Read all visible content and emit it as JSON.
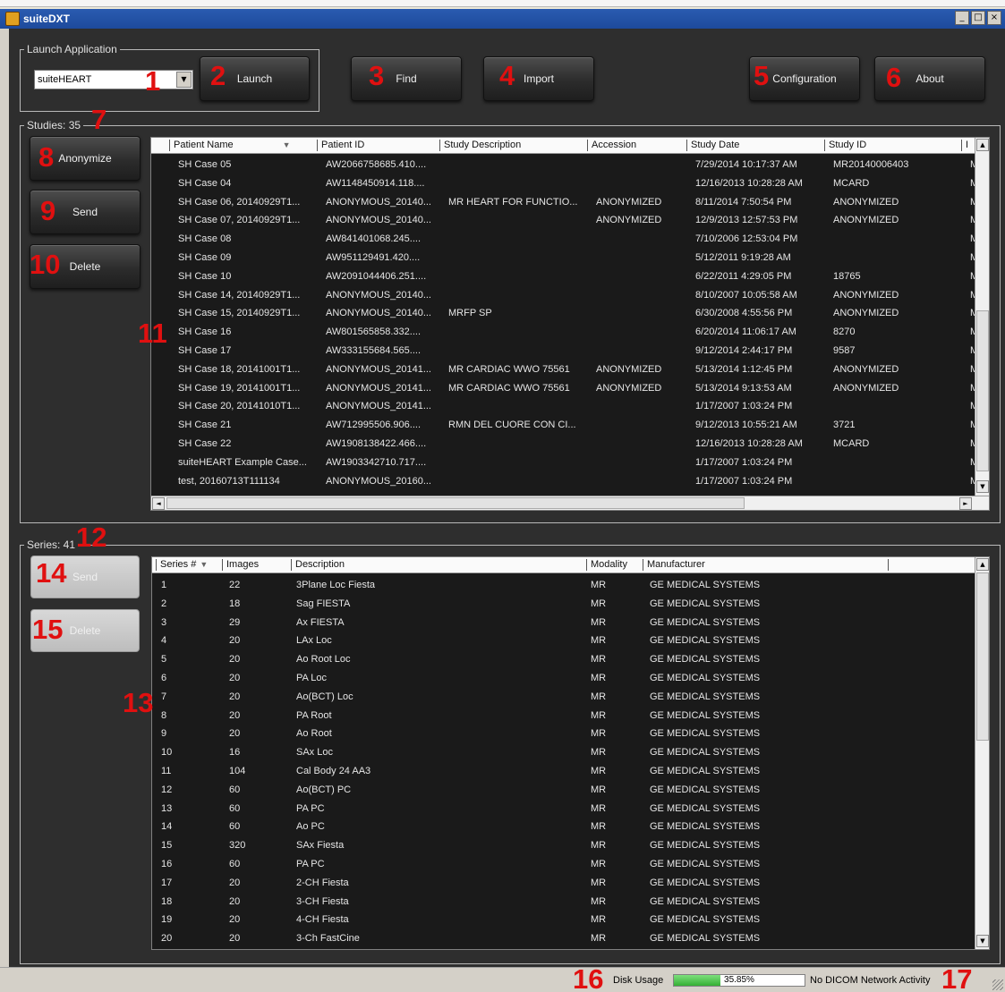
{
  "window": {
    "title": "suiteDXT",
    "minimize": "_",
    "maximize": "□",
    "close": "×"
  },
  "launch": {
    "legend": "Launch Application",
    "selected": "suiteHEART",
    "combo_arrow": "▼",
    "launch_label": "Launch"
  },
  "toolbar": {
    "find_label": "Find",
    "import_label": "Import",
    "configuration_label": "Configuration",
    "about_label": "About"
  },
  "studies": {
    "legend": "Studies: 35",
    "actions": {
      "anonymize": "Anonymize",
      "send": "Send",
      "delete": "Delete"
    },
    "sort_glyph": "▼",
    "columns": [
      "Patient Name",
      "Patient ID",
      "Study Description",
      "Accession",
      "Study Date",
      "Study ID",
      "I"
    ],
    "rows": [
      [
        "SH Case  05",
        "AW2066758685.410....",
        "",
        "",
        "7/29/2014 10:17:37 AM",
        "MR20140006403",
        "M"
      ],
      [
        "SH Case 04",
        "AW1148450914.118....",
        "",
        "",
        "12/16/2013 10:28:28 AM",
        "MCARD",
        "M"
      ],
      [
        "SH Case 06, 20140929T1...",
        "ANONYMOUS_20140...",
        "MR HEART FOR FUNCTIO...",
        "ANONYMIZED",
        "8/11/2014 7:50:54 PM",
        "ANONYMIZED",
        "M"
      ],
      [
        "SH Case 07, 20140929T1...",
        "ANONYMOUS_20140...",
        "",
        "ANONYMIZED",
        "12/9/2013 12:57:53 PM",
        "ANONYMIZED",
        "M"
      ],
      [
        "SH Case 08",
        "AW841401068.245....",
        "",
        "",
        "7/10/2006 12:53:04 PM",
        "",
        "M"
      ],
      [
        "SH Case 09",
        "AW951129491.420....",
        "",
        "",
        "5/12/2011 9:19:28 AM",
        "",
        "M"
      ],
      [
        "SH Case 10",
        "AW2091044406.251....",
        "",
        "",
        "6/22/2011 4:29:05 PM",
        "18765",
        "M"
      ],
      [
        "SH Case 14, 20140929T1...",
        "ANONYMOUS_20140...",
        "",
        "",
        "8/10/2007 10:05:58 AM",
        "ANONYMIZED",
        "M"
      ],
      [
        "SH Case 15, 20140929T1...",
        "ANONYMOUS_20140...",
        "MRFP SP",
        "",
        "6/30/2008 4:55:56 PM",
        "ANONYMIZED",
        "M"
      ],
      [
        "SH Case 16",
        "AW801565858.332....",
        "",
        "",
        "6/20/2014 11:06:17 AM",
        "8270",
        "M"
      ],
      [
        "SH Case 17",
        "AW333155684.565....",
        "",
        "",
        "9/12/2014 2:44:17 PM",
        "9587",
        "M"
      ],
      [
        "SH Case 18, 20141001T1...",
        "ANONYMOUS_20141...",
        "MR CARDIAC WWO 75561",
        "ANONYMIZED",
        "5/13/2014 1:12:45 PM",
        "ANONYMIZED",
        "M"
      ],
      [
        "SH Case 19, 20141001T1...",
        "ANONYMOUS_20141...",
        "MR CARDIAC WWO 75561",
        "ANONYMIZED",
        "5/13/2014 9:13:53 AM",
        "ANONYMIZED",
        "M"
      ],
      [
        "SH Case 20, 20141010T1...",
        "ANONYMOUS_20141...",
        "",
        "",
        "1/17/2007 1:03:24 PM",
        "",
        "M"
      ],
      [
        "SH Case 21",
        "AW712995506.906....",
        "RMN DEL CUORE CON CI...",
        "",
        "9/12/2013 10:55:21 AM",
        "3721",
        "M"
      ],
      [
        "SH Case 22",
        "AW1908138422.466....",
        "",
        "",
        "12/16/2013 10:28:28 AM",
        "MCARD",
        "M"
      ],
      [
        "suiteHEART Example Case...",
        "AW1903342710.717....",
        "",
        "",
        "1/17/2007 1:03:24 PM",
        "",
        "M"
      ],
      [
        "test, 20160713T111134",
        "ANONYMOUS_20160...",
        "",
        "",
        "1/17/2007 1:03:24 PM",
        "",
        "M"
      ]
    ]
  },
  "series": {
    "legend": "Series: 41",
    "actions": {
      "send": "Send",
      "delete": "Delete"
    },
    "sort_glyph": "▼",
    "columns": [
      "Series #",
      "Images",
      "Description",
      "Modality",
      "Manufacturer",
      ""
    ],
    "rows": [
      [
        "1",
        "22",
        "3Plane Loc Fiesta",
        "MR",
        "GE MEDICAL SYSTEMS"
      ],
      [
        "2",
        "18",
        "Sag FIESTA",
        "MR",
        "GE MEDICAL SYSTEMS"
      ],
      [
        "3",
        "29",
        "Ax FIESTA",
        "MR",
        "GE MEDICAL SYSTEMS"
      ],
      [
        "4",
        "20",
        "LAx Loc",
        "MR",
        "GE MEDICAL SYSTEMS"
      ],
      [
        "5",
        "20",
        "Ao Root Loc",
        "MR",
        "GE MEDICAL SYSTEMS"
      ],
      [
        "6",
        "20",
        "PA  Loc",
        "MR",
        "GE MEDICAL SYSTEMS"
      ],
      [
        "7",
        "20",
        "Ao(BCT) Loc",
        "MR",
        "GE MEDICAL SYSTEMS"
      ],
      [
        "8",
        "20",
        "PA Root",
        "MR",
        "GE MEDICAL SYSTEMS"
      ],
      [
        "9",
        "20",
        "Ao Root",
        "MR",
        "GE MEDICAL SYSTEMS"
      ],
      [
        "10",
        "16",
        "SAx Loc",
        "MR",
        "GE MEDICAL SYSTEMS"
      ],
      [
        "11",
        "104",
        "Cal Body 24 AA3",
        "MR",
        "GE MEDICAL SYSTEMS"
      ],
      [
        "12",
        "60",
        "Ao(BCT) PC",
        "MR",
        "GE MEDICAL SYSTEMS"
      ],
      [
        "13",
        "60",
        "PA PC",
        "MR",
        "GE MEDICAL SYSTEMS"
      ],
      [
        "14",
        "60",
        "Ao PC",
        "MR",
        "GE MEDICAL SYSTEMS"
      ],
      [
        "15",
        "320",
        "SAx Fiesta",
        "MR",
        "GE MEDICAL SYSTEMS"
      ],
      [
        "16",
        "60",
        "PA PC",
        "MR",
        "GE MEDICAL SYSTEMS"
      ],
      [
        "17",
        "20",
        "2-CH Fiesta",
        "MR",
        "GE MEDICAL SYSTEMS"
      ],
      [
        "18",
        "20",
        "3-CH Fiesta",
        "MR",
        "GE MEDICAL SYSTEMS"
      ],
      [
        "19",
        "20",
        "4-CH Fiesta",
        "MR",
        "GE MEDICAL SYSTEMS"
      ],
      [
        "20",
        "20",
        "3-Ch FastCine",
        "MR",
        "GE MEDICAL SYSTEMS"
      ]
    ]
  },
  "scroll_glyphs": {
    "up": "▲",
    "down": "▼",
    "left": "◄",
    "right": "►"
  },
  "status": {
    "disk_label": "Disk Usage",
    "disk_percent_text": "35.85%",
    "disk_fraction": 0.3585,
    "network": "No DICOM Network Activity"
  },
  "callouts": [
    "1",
    "2",
    "3",
    "4",
    "5",
    "6",
    "7",
    "8",
    "9",
    "10",
    "11",
    "12",
    "13",
    "14",
    "15",
    "16",
    "17"
  ],
  "colors": {
    "callout": "#e01010",
    "panel": "#2e2e2e",
    "disk_fill": "#34b034"
  }
}
